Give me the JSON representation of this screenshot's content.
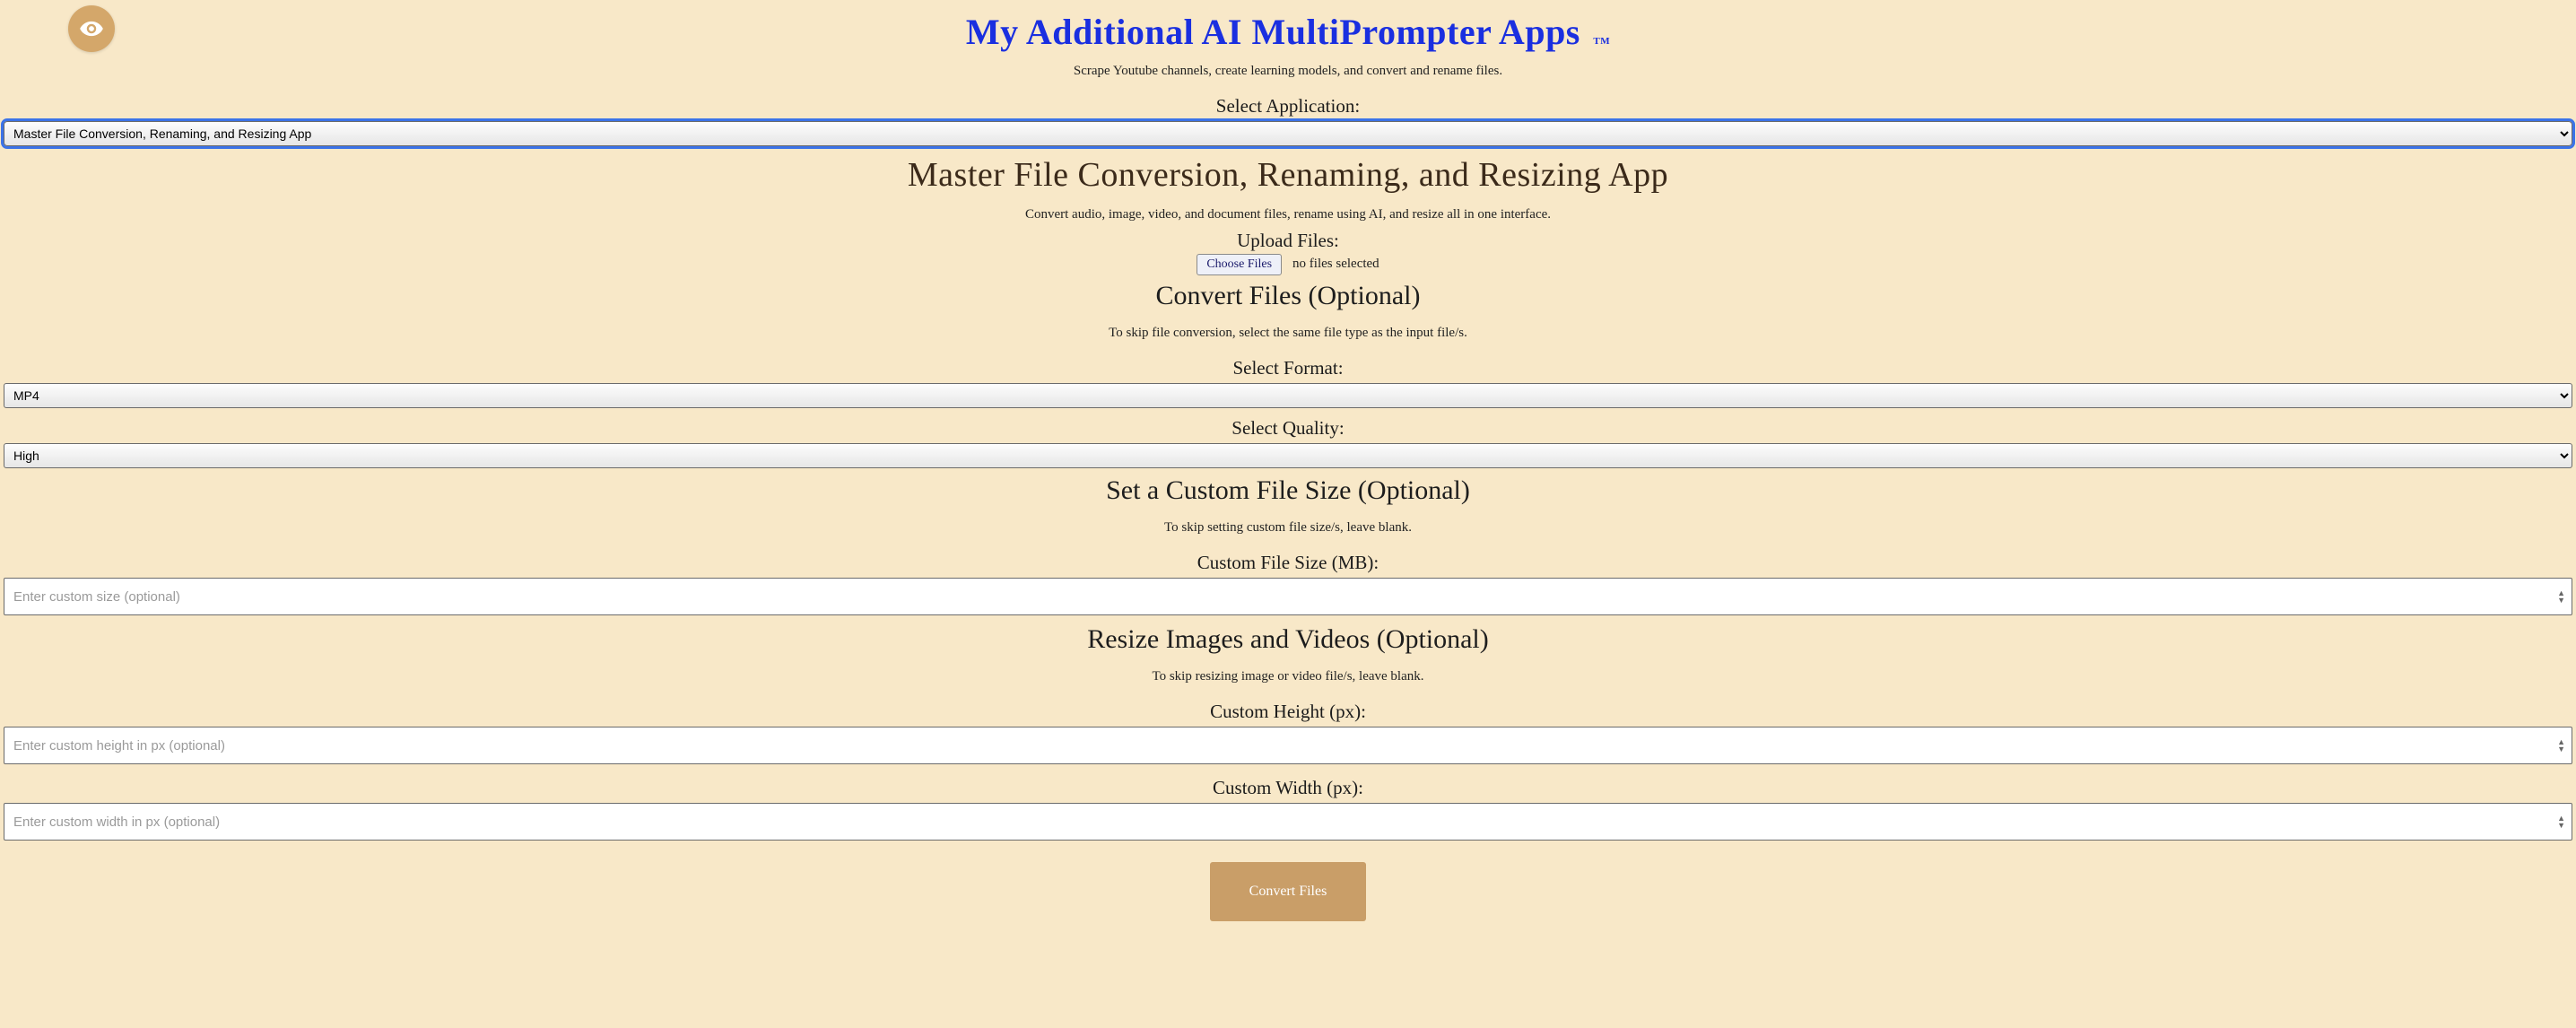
{
  "header": {
    "title": "My Additional AI MultiPrompter Apps",
    "tm": "TM",
    "subtitle": "Scrape Youtube channels, create learning models, and convert and rename files."
  },
  "app_select": {
    "label": "Select Application:",
    "value": "Master File Conversion, Renaming, and Resizing App"
  },
  "app": {
    "title": "Master File Conversion, Renaming, and Resizing App",
    "subtitle": "Convert audio, image, video, and document files, rename using AI, and resize all in one interface."
  },
  "upload": {
    "label": "Upload Files:",
    "button": "Choose Files",
    "status": "no files selected"
  },
  "convert_section": {
    "title": "Convert Files (Optional)",
    "hint": "To skip file conversion, select the same file type as the input file/s.",
    "format_label": "Select Format:",
    "format_value": "MP4",
    "quality_label": "Select Quality:",
    "quality_value": "High"
  },
  "size_section": {
    "title": "Set a Custom File Size (Optional)",
    "hint": "To skip setting custom file size/s, leave blank.",
    "size_label": "Custom File Size (MB):",
    "size_placeholder": "Enter custom size (optional)"
  },
  "resize_section": {
    "title": "Resize Images and Videos (Optional)",
    "hint": "To skip resizing image or video file/s, leave blank.",
    "height_label": "Custom Height (px):",
    "height_placeholder": "Enter custom height in px (optional)",
    "width_label": "Custom Width (px):",
    "width_placeholder": "Enter custom width in px (optional)"
  },
  "actions": {
    "convert": "Convert Files"
  }
}
